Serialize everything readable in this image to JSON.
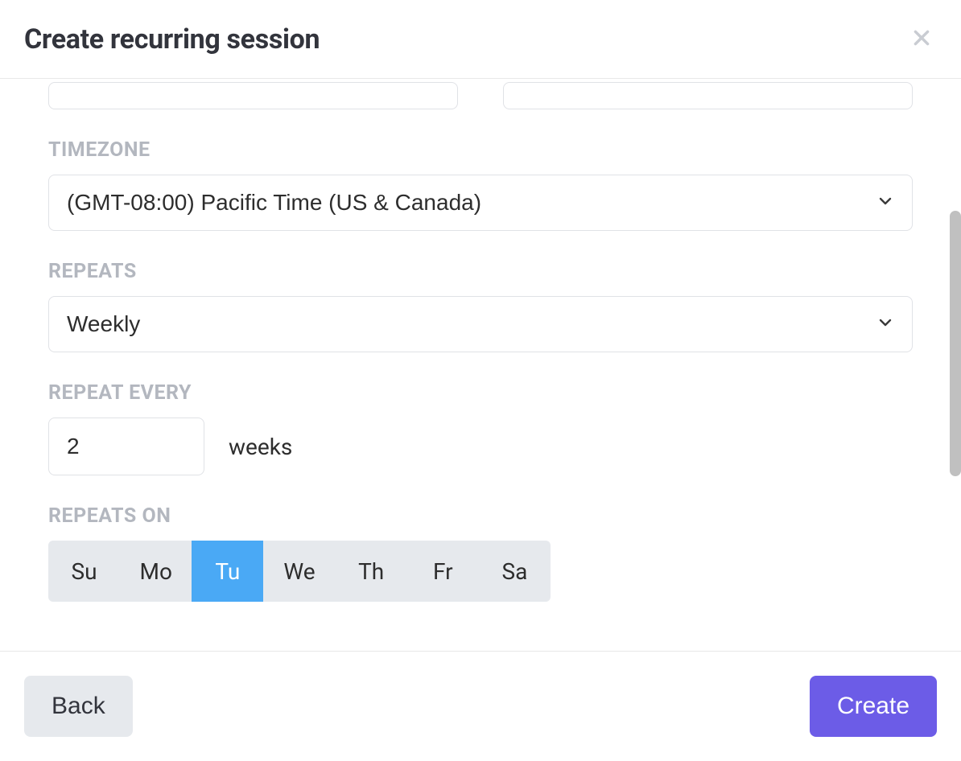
{
  "header": {
    "title": "Create recurring session"
  },
  "form": {
    "timezone": {
      "label": "TIMEZONE",
      "value": "(GMT-08:00) Pacific Time (US & Canada)"
    },
    "repeats": {
      "label": "REPEATS",
      "value": "Weekly"
    },
    "repeat_every": {
      "label": "REPEAT EVERY",
      "value": "2",
      "unit": "weeks"
    },
    "repeats_on": {
      "label": "REPEATS ON",
      "days": [
        {
          "abbr": "Su",
          "selected": false
        },
        {
          "abbr": "Mo",
          "selected": false
        },
        {
          "abbr": "Tu",
          "selected": true
        },
        {
          "abbr": "We",
          "selected": false
        },
        {
          "abbr": "Th",
          "selected": false
        },
        {
          "abbr": "Fr",
          "selected": false
        },
        {
          "abbr": "Sa",
          "selected": false
        }
      ]
    }
  },
  "footer": {
    "back_label": "Back",
    "create_label": "Create"
  },
  "colors": {
    "primary": "#6c5ce7",
    "accent": "#4aa9f5",
    "muted_label": "#b3b7bf",
    "chip_bg": "#e6e9ed"
  }
}
